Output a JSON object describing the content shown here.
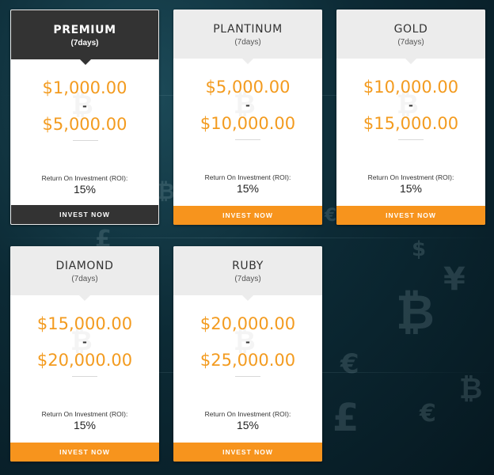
{
  "colors": {
    "accent": "#f7941d",
    "price": "#f39b1f",
    "dark": "#333333",
    "header_light": "#ececec"
  },
  "background_glyphs": [
    "₿",
    "€",
    "£",
    "$",
    "€",
    "₿",
    "¥",
    "£",
    "€",
    "₿"
  ],
  "watermark_icon": "bitcoin-icon",
  "plans": [
    {
      "name": "PREMIUM",
      "days": "(7days)",
      "price_min": "$1,000.00",
      "dash": "-",
      "price_max": "$5,000.00",
      "roi_label": "Return On Investment (ROI):",
      "roi_value": "15%",
      "button": "INVEST NOW"
    },
    {
      "name": "PLANTINUM",
      "days": "(7days)",
      "price_min": "$5,000.00",
      "dash": "-",
      "price_max": "$10,000.00",
      "roi_label": "Return On Investment (ROI):",
      "roi_value": "15%",
      "button": "INVEST NOW"
    },
    {
      "name": "GOLD",
      "days": "(7days)",
      "price_min": "$10,000.00",
      "dash": "-",
      "price_max": "$15,000.00",
      "roi_label": "Return On Investment (ROI):",
      "roi_value": "15%",
      "button": "INVEST NOW"
    },
    {
      "name": "DIAMOND",
      "days": "(7days)",
      "price_min": "$15,000.00",
      "dash": "-",
      "price_max": "$20,000.00",
      "roi_label": "Return On Investment (ROI):",
      "roi_value": "15%",
      "button": "INVEST NOW"
    },
    {
      "name": "RUBY",
      "days": "(7days)",
      "price_min": "$20,000.00",
      "dash": "-",
      "price_max": "$25,000.00",
      "roi_label": "Return On Investment (ROI):",
      "roi_value": "15%",
      "button": "INVEST NOW"
    }
  ]
}
